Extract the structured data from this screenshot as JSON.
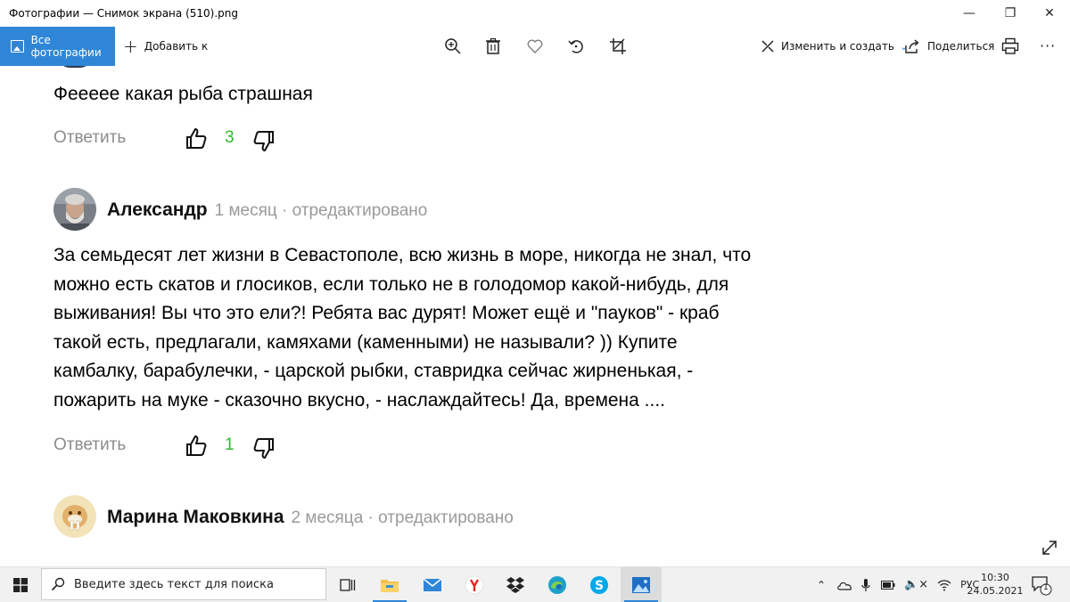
{
  "window": {
    "title": "Фотографии — Снимок экрана (510).png",
    "minimize_glyph": "—",
    "maximize_glyph": "❐",
    "close_glyph": "✕"
  },
  "toolbar": {
    "all_photos": "Все фотографии",
    "add_to": "Добавить к",
    "edit_create": "Изменить и создать",
    "share": "Поделиться",
    "more": "···",
    "icons": [
      "zoom-icon",
      "delete-icon",
      "favorite-icon",
      "rotate-icon",
      "crop-icon",
      "print-icon"
    ]
  },
  "comments": [
    {
      "text": "Феееее какая рыба страшная",
      "reply_label": "Ответить",
      "likes": "3"
    },
    {
      "author": "Александр",
      "meta": "1 месяц · отредактировано",
      "text_lines": [
        "За семьдесят лет жизни в Севастополе, всю жизнь в море, никогда не знал, что",
        "можно есть скатов и глосиков, если только не в голодомор какой-нибудь, для",
        "выживания! Вы что это ели?! Ребята вас дурят! Может ещё и \"пауков\" - краб",
        "такой есть, предлагали, камяхами (каменными) не называли? )) Купите",
        "камбалку, барабулечки, - царской рыбки, ставридка сейчас жирненькая, -",
        "пожарить на муке - сказочно вкусно, - наслаждайтесь! Да, времена ...."
      ],
      "reply_label": "Ответить",
      "likes": "1"
    },
    {
      "author": "Марина Маковкина",
      "meta": "2 месяца · отредактировано"
    }
  ],
  "taskbar": {
    "search_placeholder": "Введите здесь текст для поиска",
    "language": "РУС",
    "time": "10:30",
    "date": "24.05.2021",
    "notification_count": "1"
  },
  "colors": {
    "accent": "#2f86d6",
    "like_green": "#2db82d",
    "muted_text": "#8c8c8c"
  }
}
